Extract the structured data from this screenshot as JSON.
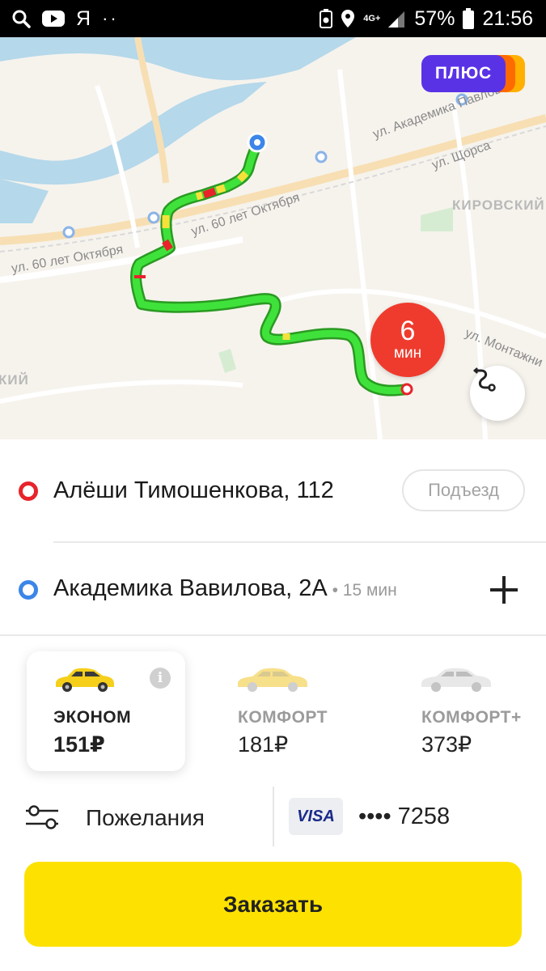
{
  "status_bar": {
    "carrier_letter": "Я",
    "dots": "··",
    "network": "4G+",
    "battery": "57%",
    "time": "21:56",
    "icons": [
      "search-icon",
      "youtube-icon",
      "battery-saver-icon",
      "location-icon",
      "signal-icon",
      "battery-icon"
    ]
  },
  "map": {
    "plus_badge": "ПЛЮС",
    "streets": {
      "academic_pavlova": "ул. Академика Павлова",
      "shchorsa": "ул. Щорса",
      "sixty_years_october_1": "ул. 60 лет Октября",
      "sixty_years_october_2": "ул. 60 лет Октября",
      "montazhnikov": "ул. Монтажни",
      "district_kirovsky": "КИРОВСКИЙ",
      "district_partial": "КИЙ"
    },
    "eta": {
      "value": "6",
      "unit": "мин"
    },
    "colors": {
      "route": "#3fe23a",
      "route_slow": "#f5e13a",
      "route_jam": "#e8232a",
      "eta": "#ef3b2d"
    }
  },
  "addresses": {
    "from": {
      "text": "Алёши Тимошенкова, 112",
      "entrance_button": "Подъезд"
    },
    "to": {
      "text": "Академика Вавилова, 2А",
      "duration": " • 15 мин"
    }
  },
  "tariffs": [
    {
      "name": "ЭКОНОМ",
      "price": "151₽",
      "selected": true,
      "car_color": "#f5cf1a"
    },
    {
      "name": "КОМФОРТ",
      "price": "181₽",
      "selected": false,
      "car_color": "#f7e08a"
    },
    {
      "name": "КОМФОРТ+",
      "price": "373₽",
      "selected": false,
      "car_color": "#e6e6e6"
    }
  ],
  "options": {
    "wishes_label": "Пожелания",
    "payment": {
      "card_brand": "VISA",
      "card_number": "•••• 7258"
    }
  },
  "order_button": "Заказать",
  "accent": "#fde201"
}
